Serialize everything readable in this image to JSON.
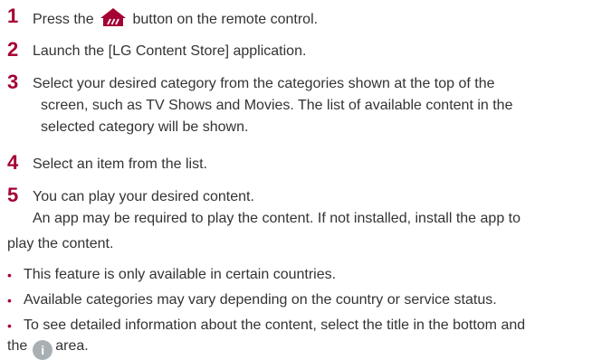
{
  "steps": [
    {
      "number": "1",
      "before_icon": "Press the",
      "after_icon": "button on the remote control.",
      "icon": "home-icon"
    },
    {
      "number": "2",
      "text": "Launch the [LG Content Store] application."
    },
    {
      "number": "3",
      "lines": [
        "Select your desired category from the categories shown at the top of the",
        "screen, such as TV Shows and Movies. The list of available content in the",
        "selected category will be shown."
      ]
    },
    {
      "number": "4",
      "text": "Select an item from the list."
    },
    {
      "number": "5",
      "lines": [
        "You can play your desired content.",
        "An app may be required to play the content. If not installed, install the app to",
        "play the content."
      ]
    }
  ],
  "notes": [
    {
      "bullet": "•",
      "text": "This feature is only available in certain countries."
    },
    {
      "bullet": "•",
      "text": "Available categories may vary depending on the country or service status."
    },
    {
      "bullet": "•",
      "line1": "To see detailed information about the content, select the title in the bottom and",
      "line2_before": "the",
      "info_icon_label": "i",
      "line2_after": "area."
    }
  ],
  "colors": {
    "accent": "#a50034",
    "text": "#333333",
    "icon_bg": "#a9b0b3"
  }
}
